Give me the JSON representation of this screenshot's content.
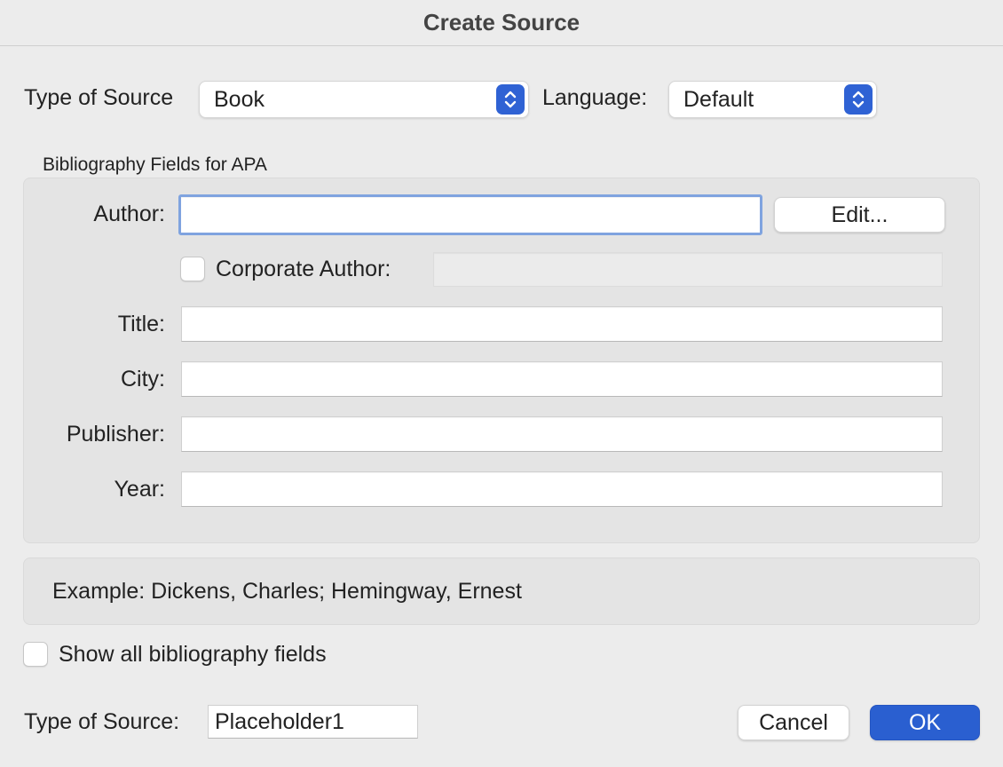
{
  "window": {
    "title": "Create Source"
  },
  "source_type": {
    "label": "Type of Source",
    "value": "Book"
  },
  "language": {
    "label": "Language:",
    "value": "Default"
  },
  "group": {
    "title": "Bibliography Fields for APA",
    "author": {
      "label": "Author:",
      "value": "",
      "edit_button": "Edit..."
    },
    "corporate_author": {
      "label": "Corporate Author:",
      "checked": false,
      "value": ""
    },
    "title_field": {
      "label": "Title:",
      "value": ""
    },
    "city": {
      "label": "City:",
      "value": ""
    },
    "publisher": {
      "label": "Publisher:",
      "value": ""
    },
    "year": {
      "label": "Year:",
      "value": ""
    }
  },
  "example": {
    "text": "Example: Dickens, Charles; Hemingway, Ernest"
  },
  "show_all": {
    "label": "Show all bibliography fields",
    "checked": false
  },
  "tag": {
    "label": "Type of Source:",
    "value": "Placeholder1"
  },
  "buttons": {
    "cancel": "Cancel",
    "ok": "OK"
  },
  "colors": {
    "accent": "#2a5fd0",
    "focus_ring": "#7fa3df"
  }
}
